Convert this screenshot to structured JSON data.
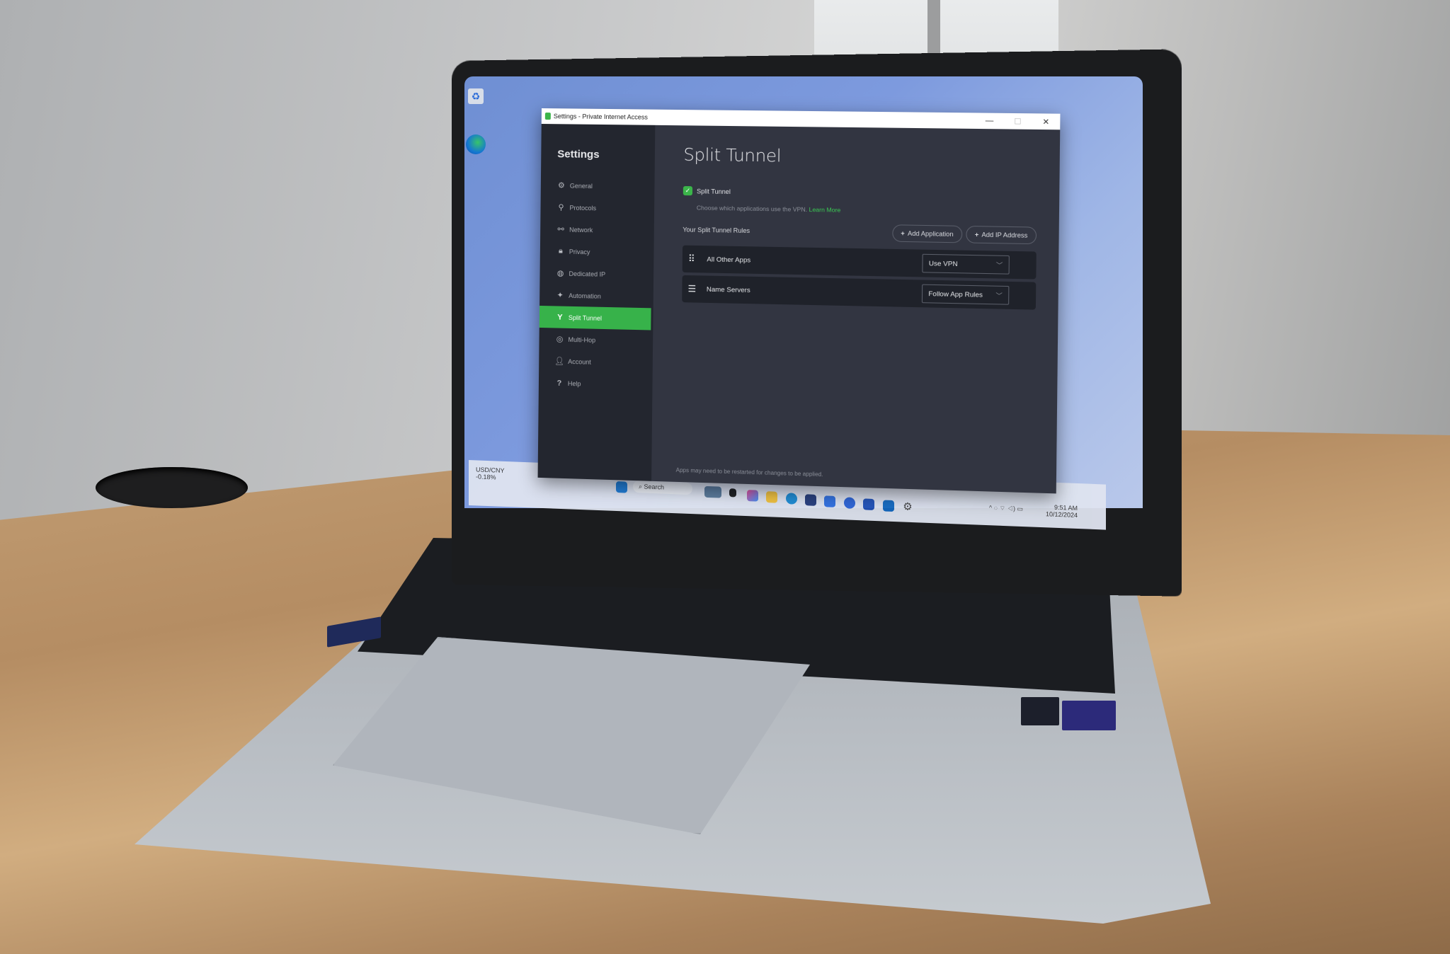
{
  "window": {
    "title": "Settings - Private Internet Access",
    "controls": {
      "minimize": "—",
      "maximize": "☐",
      "close": "✕"
    }
  },
  "sidebar": {
    "heading": "Settings",
    "items": [
      {
        "label": "General",
        "icon": "gear-icon",
        "glyph": "⚙",
        "active": false
      },
      {
        "label": "Protocols",
        "icon": "protocols-icon",
        "glyph": "⚲",
        "active": false
      },
      {
        "label": "Network",
        "icon": "network-icon",
        "glyph": "⚯",
        "active": false
      },
      {
        "label": "Privacy",
        "icon": "lock-icon",
        "glyph": "🔒︎",
        "active": false
      },
      {
        "label": "Dedicated IP",
        "icon": "dedicated-ip-icon",
        "glyph": "◍",
        "active": false
      },
      {
        "label": "Automation",
        "icon": "lightbulb-icon",
        "glyph": "✦",
        "active": false
      },
      {
        "label": "Split Tunnel",
        "icon": "split-tunnel-icon",
        "glyph": "Y",
        "active": true
      },
      {
        "label": "Multi-Hop",
        "icon": "globe-icon",
        "glyph": "◎",
        "active": false
      },
      {
        "label": "Account",
        "icon": "user-icon",
        "glyph": "👤︎",
        "active": false
      },
      {
        "label": "Help",
        "icon": "help-icon",
        "glyph": "?",
        "active": false
      }
    ]
  },
  "main": {
    "title": "Split Tunnel",
    "split_tunnel_toggle": {
      "label": "Split Tunnel",
      "checked": true,
      "check_glyph": "✓"
    },
    "description": "Choose which applications use the VPN.",
    "learn_more": "Learn More",
    "rules_heading": "Your Split Tunnel Rules",
    "add_application": "Add Application",
    "add_ip_address": "Add IP Address",
    "plus_glyph": "+",
    "rules": [
      {
        "name": "All Other Apps",
        "icon": "app-grid-icon",
        "glyph": "⠿",
        "value": "Use VPN"
      },
      {
        "name": "Name Servers",
        "icon": "server-icon",
        "glyph": "☰",
        "value": "Follow App Rules"
      }
    ],
    "chevron_glyph": "﹀",
    "footnote": "Apps may need to be restarted for changes to be applied."
  },
  "taskbar": {
    "widget_title": "USD/CNY",
    "widget_value": "-0.18%",
    "search_placeholder": "Search",
    "time": "9:51 AM",
    "date": "10/12/2024"
  },
  "colors": {
    "accent_green": "#37b24a",
    "sidebar_bg": "#23262f",
    "main_bg": "#323541",
    "row_bg": "#1f222a"
  }
}
